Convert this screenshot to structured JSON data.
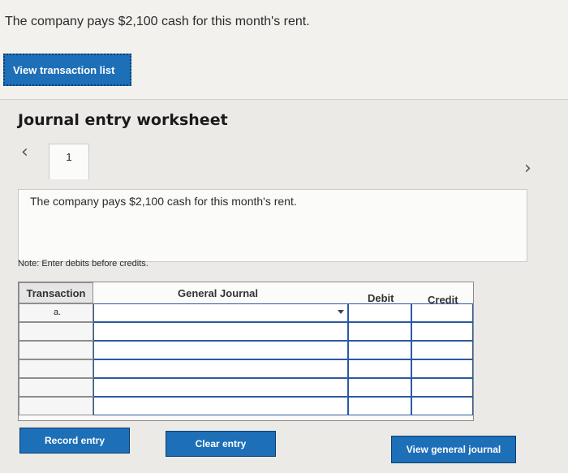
{
  "question": "The company pays $2,100 cash for this month's rent.",
  "view_list_label": "View transaction list",
  "worksheet": {
    "title": "Journal entry worksheet",
    "tab_number": "1",
    "prev_icon": "chevron-left-icon",
    "next_icon": "chevron-right-icon",
    "description": "The company pays $2,100 cash for this month's rent.",
    "note": "Note: Enter debits before credits."
  },
  "journal": {
    "headers": {
      "transaction": "Transaction",
      "account": "General Journal",
      "debit": "Debit",
      "credit": "Credit"
    },
    "rows": [
      {
        "transaction": "a."
      },
      {
        "transaction": ""
      },
      {
        "transaction": ""
      },
      {
        "transaction": ""
      },
      {
        "transaction": ""
      },
      {
        "transaction": ""
      }
    ]
  },
  "buttons": {
    "record": "Record entry",
    "clear": "Clear entry",
    "view_journal": "View general journal"
  }
}
